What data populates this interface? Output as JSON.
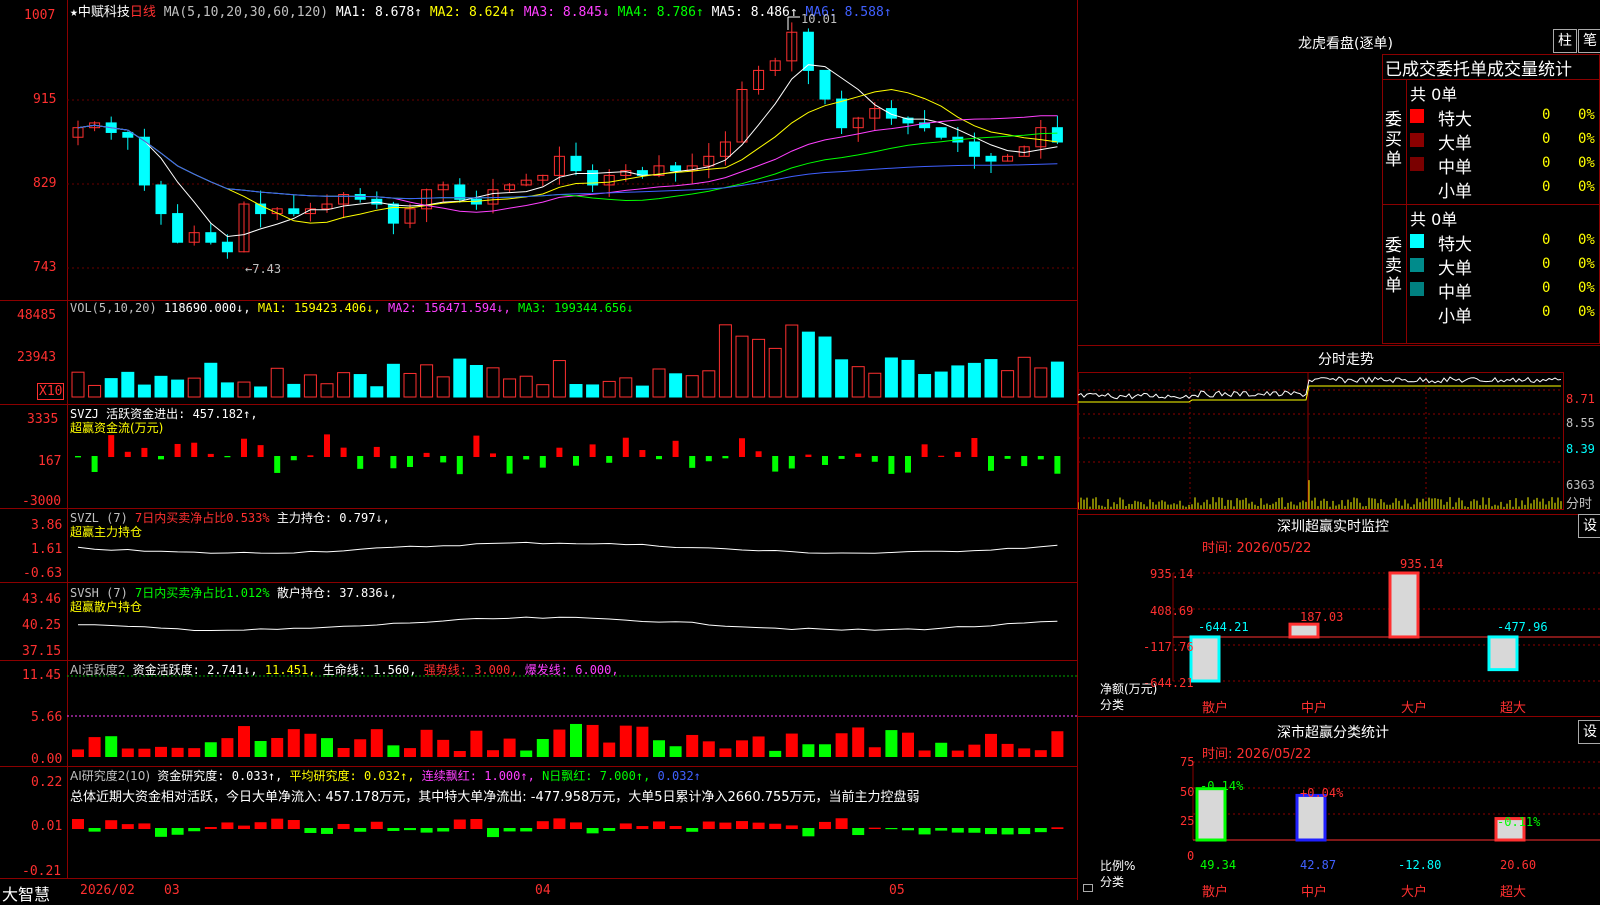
{
  "header": {
    "star": "★",
    "stock_name": "中赋科技",
    "period": "日线",
    "ma_params": "MA(5,10,20,30,60,120)",
    "ma1": "MA1: 8.678↑",
    "ma2": "MA2: 8.624↑",
    "ma3": "MA3: 8.845↓",
    "ma4": "MA4: 8.786↑",
    "ma5": "MA5: 8.486↑",
    "ma6": "MA6: 8.588↑",
    "high_mark": "10.01",
    "low_mark": "←7.43"
  },
  "price_axis": [
    "1007",
    "915",
    "829",
    "743"
  ],
  "vol": {
    "title": "VOL(5,10,20)",
    "value": "118690.000↓,",
    "ma1": "MA1: 159423.406↓,",
    "ma2": "MA2: 156471.594↓,",
    "ma3": "MA3: 199344.656↓",
    "axis": [
      "48485",
      "23943"
    ],
    "unit": "X10"
  },
  "svzj": {
    "line1": "SVZJ  活跃资金进出: 457.182↑,",
    "line2": "超赢资金流(万元)",
    "axis": [
      "3335",
      "167",
      "-3000"
    ]
  },
  "svzl": {
    "title": "SVZL (7)",
    "part1": "7日内买卖净占比0.533%",
    "part2": "主力持仓: 0.797↓,",
    "line2": "超赢主力持仓",
    "axis": [
      "3.86",
      "1.61",
      "-0.63"
    ]
  },
  "svsh": {
    "title": "SVSH (7)",
    "part1": "7日内买卖净占比1.012%",
    "part2": "散户持仓: 37.836↓,",
    "line2": "超赢散户持仓",
    "axis": [
      "43.46",
      "40.25",
      "37.15"
    ]
  },
  "ai_active": {
    "title": "AI活跃度2",
    "part1": "资金活跃度: 2.741↓,",
    "part2": "11.451,",
    "part3": "生命线: 1.560,",
    "part4": "强势线: 3.000,",
    "part5": "爆发线: 6.000,",
    "axis": [
      "11.45",
      "5.66",
      "0.00"
    ]
  },
  "ai_research": {
    "title": "AI研究度2(10)",
    "part1": "资金研究度: 0.033↑,",
    "part2": "平均研究度: 0.032↑,",
    "part3": "连续飘红: 1.000↑,",
    "part4": "N日飘红: 7.000↑,",
    "part5": "0.032↑",
    "summary": "总体近期大资金相对活跃，今日大单净流入: 457.178万元，其中特大单净流出: -477.958万元，大单5日累计净入2660.755万元，当前主力控盘弱",
    "axis": [
      "0.22",
      "0.01",
      "-0.21"
    ]
  },
  "footer": {
    "brand": "大智慧",
    "dates": [
      "2026/02",
      "03",
      "04",
      "05"
    ]
  },
  "longhu": {
    "title": "龙虎看盘(逐单)",
    "btn1": "柱",
    "btn2": "笔",
    "subtitle": "已成交委托单成交量统计",
    "buy_label": "委买单",
    "sell_label": "委卖单",
    "buy_total": "共 0单",
    "sell_total": "共 0单",
    "buy_rows": [
      {
        "label": "特大",
        "val": "0",
        "pct": "0%",
        "color": "#ff0000"
      },
      {
        "label": "大单",
        "val": "0",
        "pct": "0%",
        "color": "#8b0000"
      },
      {
        "label": "中单",
        "val": "0",
        "pct": "0%",
        "color": "#7a0000"
      },
      {
        "label": "小单",
        "val": "0",
        "pct": "0%",
        "color": ""
      }
    ],
    "sell_rows": [
      {
        "label": "特大",
        "val": "0",
        "pct": "0%",
        "color": "#00ffff"
      },
      {
        "label": "大单",
        "val": "0",
        "pct": "0%",
        "color": "#008b8b"
      },
      {
        "label": "中单",
        "val": "0",
        "pct": "0%",
        "color": "#008080"
      },
      {
        "label": "小单",
        "val": "0",
        "pct": "0%",
        "color": ""
      }
    ]
  },
  "intraday": {
    "title": "分时走势",
    "axis": [
      "8.71",
      "8.55",
      "8.39"
    ],
    "vol_label": "6363",
    "unit": "分时"
  },
  "sz_monitor": {
    "title": "深圳超赢实时监控",
    "btn": "设",
    "time": "时间: 2026/05/22",
    "axis": [
      "935.14",
      "408.69",
      "-117.76",
      "-644.21"
    ],
    "ylabel1": "净额(万元)",
    "ylabel2": "分类",
    "categories": [
      "散户",
      "中户",
      "大户",
      "超大"
    ],
    "values_text": [
      "-644.21",
      "187.03",
      "935.14",
      "-477.96"
    ]
  },
  "sz_class": {
    "title": "深市超赢分类统计",
    "btn": "设",
    "time": "时间: 2026/05/22",
    "axis": [
      "75",
      "50",
      "25",
      "0"
    ],
    "ylabel1": "比例%",
    "ylabel2": "分类",
    "categories": [
      "散户",
      "中户",
      "大户",
      "超大"
    ],
    "change_text": [
      "-0.14%",
      "+0.04%",
      "",
      "-0.11%"
    ],
    "values_text": [
      "49.34",
      "42.87",
      "-12.80",
      "20.60"
    ]
  },
  "chart_data": [
    {
      "type": "bar",
      "title": "深圳超赢实时监控",
      "categories": [
        "散户",
        "中户",
        "大户",
        "超大"
      ],
      "values": [
        -644.21,
        187.03,
        935.14,
        -477.96
      ],
      "ylim": [
        -644.21,
        935.14
      ],
      "ylabel": "净额(万元)"
    },
    {
      "type": "bar",
      "title": "深市超赢分类统计",
      "categories": [
        "散户",
        "中户",
        "大户",
        "超大"
      ],
      "values": [
        49.34,
        42.87,
        -12.8,
        20.6
      ],
      "ylim": [
        0,
        75
      ],
      "ylabel": "比例%"
    }
  ]
}
